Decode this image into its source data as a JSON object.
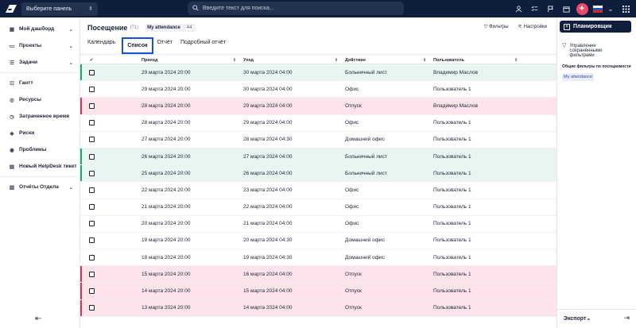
{
  "topbar": {
    "panel_select": "Выберите панель",
    "search_placeholder": "Введите текст для поиска...",
    "accent_color": "#e84a6a"
  },
  "sidebar": {
    "items": [
      {
        "label": "Мой дашборд",
        "icon": "dashboard-icon",
        "chevron": true
      },
      {
        "label": "Проекты",
        "icon": "folder-icon",
        "chevron": true
      },
      {
        "label": "Задачи",
        "icon": "tasks-icon",
        "chevron": true
      },
      {
        "label": "Гантт",
        "icon": "gantt-icon",
        "chevron": false
      },
      {
        "label": "Ресурсы",
        "icon": "resources-icon",
        "chevron": false
      },
      {
        "label": "Затраченное время",
        "icon": "clock-icon",
        "chevron": false
      },
      {
        "label": "Риски",
        "icon": "risk-icon",
        "chevron": false
      },
      {
        "label": "Проблемы",
        "icon": "problem-icon",
        "chevron": false
      },
      {
        "label": "Новый HelpDesk тикет",
        "icon": "ticket-icon",
        "chevron": false
      },
      {
        "label": "Отчёты Отдела",
        "icon": "report-icon",
        "chevron": true
      }
    ]
  },
  "main": {
    "title": "Посещение",
    "count": "(71)",
    "tag_label": "My attendance",
    "tag_count": "44",
    "filters_label": "Фильтры",
    "settings_label": "Настройки",
    "tabs": [
      {
        "label": "Календарь",
        "active": false
      },
      {
        "label": "Список",
        "active": true
      },
      {
        "label": "Отчёт",
        "active": false
      },
      {
        "label": "Подробный отчёт",
        "active": false
      }
    ],
    "columns": [
      "Приход",
      "Уход",
      "Действие",
      "Пользователь"
    ],
    "rows": [
      {
        "in": "29 марта 2024 20:00",
        "out": "30 марта 2024 04:00",
        "action": "Больничный лист",
        "user": "Владимир Маслов",
        "tone": "green"
      },
      {
        "in": "29 марта 2024 20:00",
        "out": "30 марта 2024 04:00",
        "action": "Офис",
        "user": "Пользователь 1",
        "tone": "none"
      },
      {
        "in": "28 марта 2024 20:00",
        "out": "29 марта 2024 04:00",
        "action": "Отпуск",
        "user": "Владимир Маслов",
        "tone": "pink"
      },
      {
        "in": "28 марта 2024 20:00",
        "out": "29 марта 2024 04:00",
        "action": "Офис",
        "user": "Пользователь 1",
        "tone": "none"
      },
      {
        "in": "27 марта 2024 20:00",
        "out": "28 марта 2024 04:30",
        "action": "Домашний офис",
        "user": "Пользователь 1",
        "tone": "none"
      },
      {
        "in": "26 марта 2024 20:00",
        "out": "27 марта 2024 04:00",
        "action": "Больничный лист",
        "user": "Пользователь 1",
        "tone": "green"
      },
      {
        "in": "25 марта 2024 20:00",
        "out": "26 марта 2024 04:00",
        "action": "Больничный лист",
        "user": "Пользователь 1",
        "tone": "green"
      },
      {
        "in": "22 марта 2024 20:00",
        "out": "23 марта 2024 04:00",
        "action": "Офис",
        "user": "Пользователь 1",
        "tone": "none"
      },
      {
        "in": "21 марта 2024 20:00",
        "out": "22 марта 2024 04:00",
        "action": "Офис",
        "user": "Пользователь 1",
        "tone": "none"
      },
      {
        "in": "20 марта 2024 20:00",
        "out": "21 марта 2024 04:00",
        "action": "Офис",
        "user": "Пользователь 1",
        "tone": "none"
      },
      {
        "in": "19 марта 2024 20:00",
        "out": "20 марта 2024 04:30",
        "action": "Домашний офис",
        "user": "Пользователь 1",
        "tone": "none"
      },
      {
        "in": "18 марта 2024 20:00",
        "out": "19 марта 2024 04:30",
        "action": "Домашний офис",
        "user": "Пользователь 1",
        "tone": "none"
      },
      {
        "in": "15 марта 2024 20:00",
        "out": "16 марта 2024 04:00",
        "action": "Отпуск",
        "user": "Пользователь 1",
        "tone": "pink"
      },
      {
        "in": "14 марта 2024 20:00",
        "out": "15 марта 2024 04:00",
        "action": "Отпуск",
        "user": "Пользователь 1",
        "tone": "pink"
      },
      {
        "in": "13 марта 2024 20:00",
        "out": "14 марта 2024 04:00",
        "action": "Отпуск",
        "user": "Пользователь 1",
        "tone": "pink"
      }
    ]
  },
  "right_panel": {
    "planner_label": "Планировщик",
    "saved_filters_label": "Управление сохранёнными фильтрами",
    "common_filters_title": "Общие фильтры по посещаемости",
    "filter_badge": "My attendance",
    "export_label": "Экспорт"
  }
}
